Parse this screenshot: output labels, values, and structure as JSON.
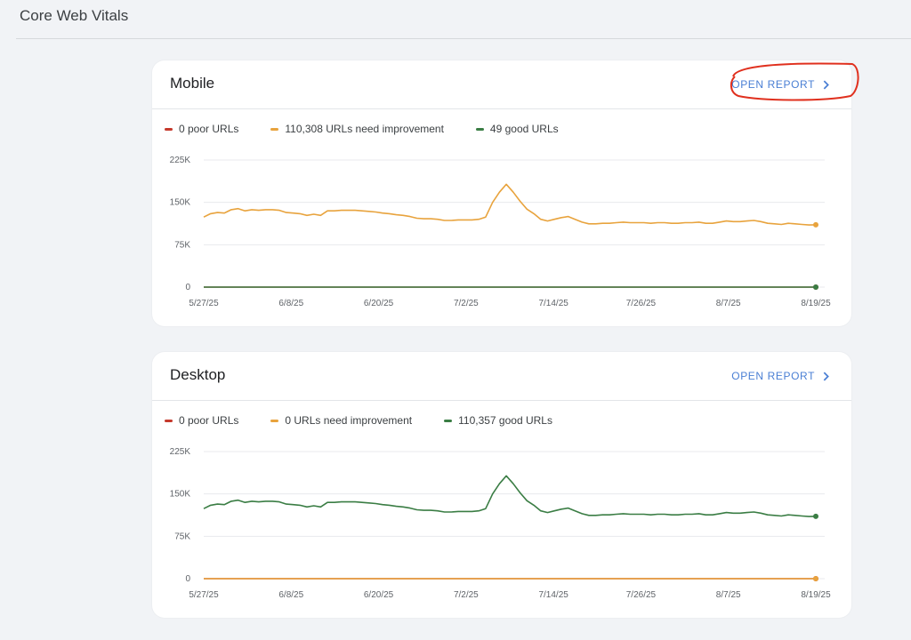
{
  "page": {
    "title": "Core Web Vitals"
  },
  "colors": {
    "poor": "#c5392c",
    "improve": "#e8a33d",
    "good": "#3a7d44",
    "link": "#4a7fd4",
    "annotation": "#e0301e"
  },
  "cards": [
    {
      "id": "mobile",
      "title": "Mobile",
      "open_report_label": "OPEN REPORT",
      "legend": [
        {
          "label": "0 poor URLs",
          "color": "#c5392c"
        },
        {
          "label": "110,308 URLs need improvement",
          "color": "#e8a33d"
        },
        {
          "label": "49 good URLs",
          "color": "#3a7d44"
        }
      ]
    },
    {
      "id": "desktop",
      "title": "Desktop",
      "open_report_label": "OPEN REPORT",
      "legend": [
        {
          "label": "0 poor URLs",
          "color": "#c5392c"
        },
        {
          "label": "0 URLs need improvement",
          "color": "#e8a33d"
        },
        {
          "label": "110,357 good URLs",
          "color": "#3a7d44"
        }
      ]
    }
  ],
  "chart_data": [
    {
      "type": "line",
      "chart": "mobile",
      "x_ticks": [
        "5/27/25",
        "6/8/25",
        "6/20/25",
        "7/2/25",
        "7/14/25",
        "7/26/25",
        "8/7/25",
        "8/19/25"
      ],
      "y_ticks": [
        "225K",
        "150K",
        "75K",
        "0"
      ],
      "ylim": [
        0,
        225000
      ],
      "series": [
        {
          "name": "0 poor URLs",
          "color": "#c5392c",
          "values": [
            0,
            0,
            0,
            0,
            0,
            0,
            0,
            0,
            0,
            0,
            0,
            0,
            0,
            0,
            0,
            0,
            0,
            0,
            0,
            0,
            0,
            0,
            0,
            0,
            0,
            0,
            0,
            0,
            0,
            0,
            0,
            0,
            0,
            0,
            0,
            0,
            0,
            0,
            0,
            0,
            0,
            0,
            0,
            0,
            0,
            0,
            0,
            0,
            0,
            0,
            0,
            0,
            0,
            0,
            0,
            0,
            0,
            0,
            0,
            0,
            0,
            0,
            0,
            0,
            0,
            0,
            0,
            0,
            0,
            0,
            0,
            0,
            0,
            0,
            0,
            0,
            0,
            0,
            0,
            0,
            0,
            0,
            0,
            0,
            0,
            0,
            0,
            0,
            0,
            0,
            0
          ]
        },
        {
          "name": "110,308 URLs need improvement",
          "color": "#e8a33d",
          "values": [
            124000,
            130000,
            132000,
            131000,
            137000,
            139000,
            135000,
            137000,
            136000,
            137000,
            137000,
            136000,
            132000,
            131000,
            130000,
            127000,
            129000,
            127000,
            135000,
            135000,
            136000,
            136000,
            136000,
            135000,
            134000,
            133000,
            131000,
            130000,
            128000,
            127000,
            125000,
            122000,
            121000,
            121000,
            120000,
            118000,
            118000,
            119000,
            119000,
            119000,
            120000,
            124000,
            150000,
            168000,
            182000,
            168000,
            152000,
            138000,
            130000,
            120000,
            117000,
            120000,
            123000,
            125000,
            120000,
            115000,
            112000,
            112000,
            113000,
            113000,
            114000,
            115000,
            114000,
            114000,
            114000,
            113000,
            114000,
            114000,
            113000,
            113000,
            114000,
            114000,
            115000,
            113000,
            113000,
            115000,
            117000,
            116000,
            116000,
            117000,
            118000,
            116000,
            113000,
            112000,
            111000,
            113000,
            112000,
            111000,
            110000,
            110308
          ]
        },
        {
          "name": "49 good URLs",
          "color": "#3a7d44",
          "values": [
            49,
            49,
            49,
            49,
            49,
            49,
            49,
            49,
            49,
            49,
            49,
            49,
            49,
            49,
            49,
            49,
            49,
            49,
            49,
            49,
            49,
            49,
            49,
            49,
            49,
            49,
            49,
            49,
            49,
            49,
            49,
            49,
            49,
            49,
            49,
            49,
            49,
            49,
            49,
            49,
            49,
            49,
            49,
            49,
            49,
            49,
            49,
            49,
            49,
            49,
            49,
            49,
            49,
            49,
            49,
            49,
            49,
            49,
            49,
            49,
            49,
            49,
            49,
            49,
            49,
            49,
            49,
            49,
            49,
            49,
            49,
            49,
            49,
            49,
            49,
            49,
            49,
            49,
            49,
            49,
            49,
            49,
            49,
            49,
            49,
            49,
            49,
            49,
            49,
            49
          ]
        }
      ]
    },
    {
      "type": "line",
      "chart": "desktop",
      "x_ticks": [
        "5/27/25",
        "6/8/25",
        "6/20/25",
        "7/2/25",
        "7/14/25",
        "7/26/25",
        "8/7/25",
        "8/19/25"
      ],
      "y_ticks": [
        "225K",
        "150K",
        "75K",
        "0"
      ],
      "ylim": [
        0,
        225000
      ],
      "series": [
        {
          "name": "0 poor URLs",
          "color": "#c5392c",
          "values": [
            0,
            0,
            0,
            0,
            0,
            0,
            0,
            0,
            0,
            0,
            0,
            0,
            0,
            0,
            0,
            0,
            0,
            0,
            0,
            0,
            0,
            0,
            0,
            0,
            0,
            0,
            0,
            0,
            0,
            0,
            0,
            0,
            0,
            0,
            0,
            0,
            0,
            0,
            0,
            0,
            0,
            0,
            0,
            0,
            0,
            0,
            0,
            0,
            0,
            0,
            0,
            0,
            0,
            0,
            0,
            0,
            0,
            0,
            0,
            0,
            0,
            0,
            0,
            0,
            0,
            0,
            0,
            0,
            0,
            0,
            0,
            0,
            0,
            0,
            0,
            0,
            0,
            0,
            0,
            0,
            0,
            0,
            0,
            0,
            0,
            0,
            0,
            0,
            0,
            0,
            0
          ]
        },
        {
          "name": "0 URLs need improvement",
          "color": "#e8a33d",
          "values": [
            0,
            0,
            0,
            0,
            0,
            0,
            0,
            0,
            0,
            0,
            0,
            0,
            0,
            0,
            0,
            0,
            0,
            0,
            0,
            0,
            0,
            0,
            0,
            0,
            0,
            0,
            0,
            0,
            0,
            0,
            0,
            0,
            0,
            0,
            0,
            0,
            0,
            0,
            0,
            0,
            0,
            0,
            0,
            0,
            0,
            0,
            0,
            0,
            0,
            0,
            0,
            0,
            0,
            0,
            0,
            0,
            0,
            0,
            0,
            0,
            0,
            0,
            0,
            0,
            0,
            0,
            0,
            0,
            0,
            0,
            0,
            0,
            0,
            0,
            0,
            0,
            0,
            0,
            0,
            0,
            0,
            0,
            0,
            0,
            0,
            0,
            0,
            0,
            0,
            0,
            0
          ]
        },
        {
          "name": "110,357 good URLs",
          "color": "#3a7d44",
          "values": [
            124000,
            130000,
            132000,
            131000,
            137000,
            139000,
            135000,
            137000,
            136000,
            137000,
            137000,
            136000,
            132000,
            131000,
            130000,
            127000,
            129000,
            127000,
            135000,
            135000,
            136000,
            136000,
            136000,
            135000,
            134000,
            133000,
            131000,
            130000,
            128000,
            127000,
            125000,
            122000,
            121000,
            121000,
            120000,
            118000,
            118000,
            119000,
            119000,
            119000,
            120000,
            124000,
            150000,
            168000,
            182000,
            168000,
            152000,
            138000,
            130000,
            120000,
            117000,
            120000,
            123000,
            125000,
            120000,
            115000,
            112000,
            112000,
            113000,
            113000,
            114000,
            115000,
            114000,
            114000,
            114000,
            113000,
            114000,
            114000,
            113000,
            113000,
            114000,
            114000,
            115000,
            113000,
            113000,
            115000,
            117000,
            116000,
            116000,
            117000,
            118000,
            116000,
            113000,
            112000,
            111000,
            113000,
            112000,
            111000,
            110000,
            110357
          ]
        }
      ]
    }
  ]
}
